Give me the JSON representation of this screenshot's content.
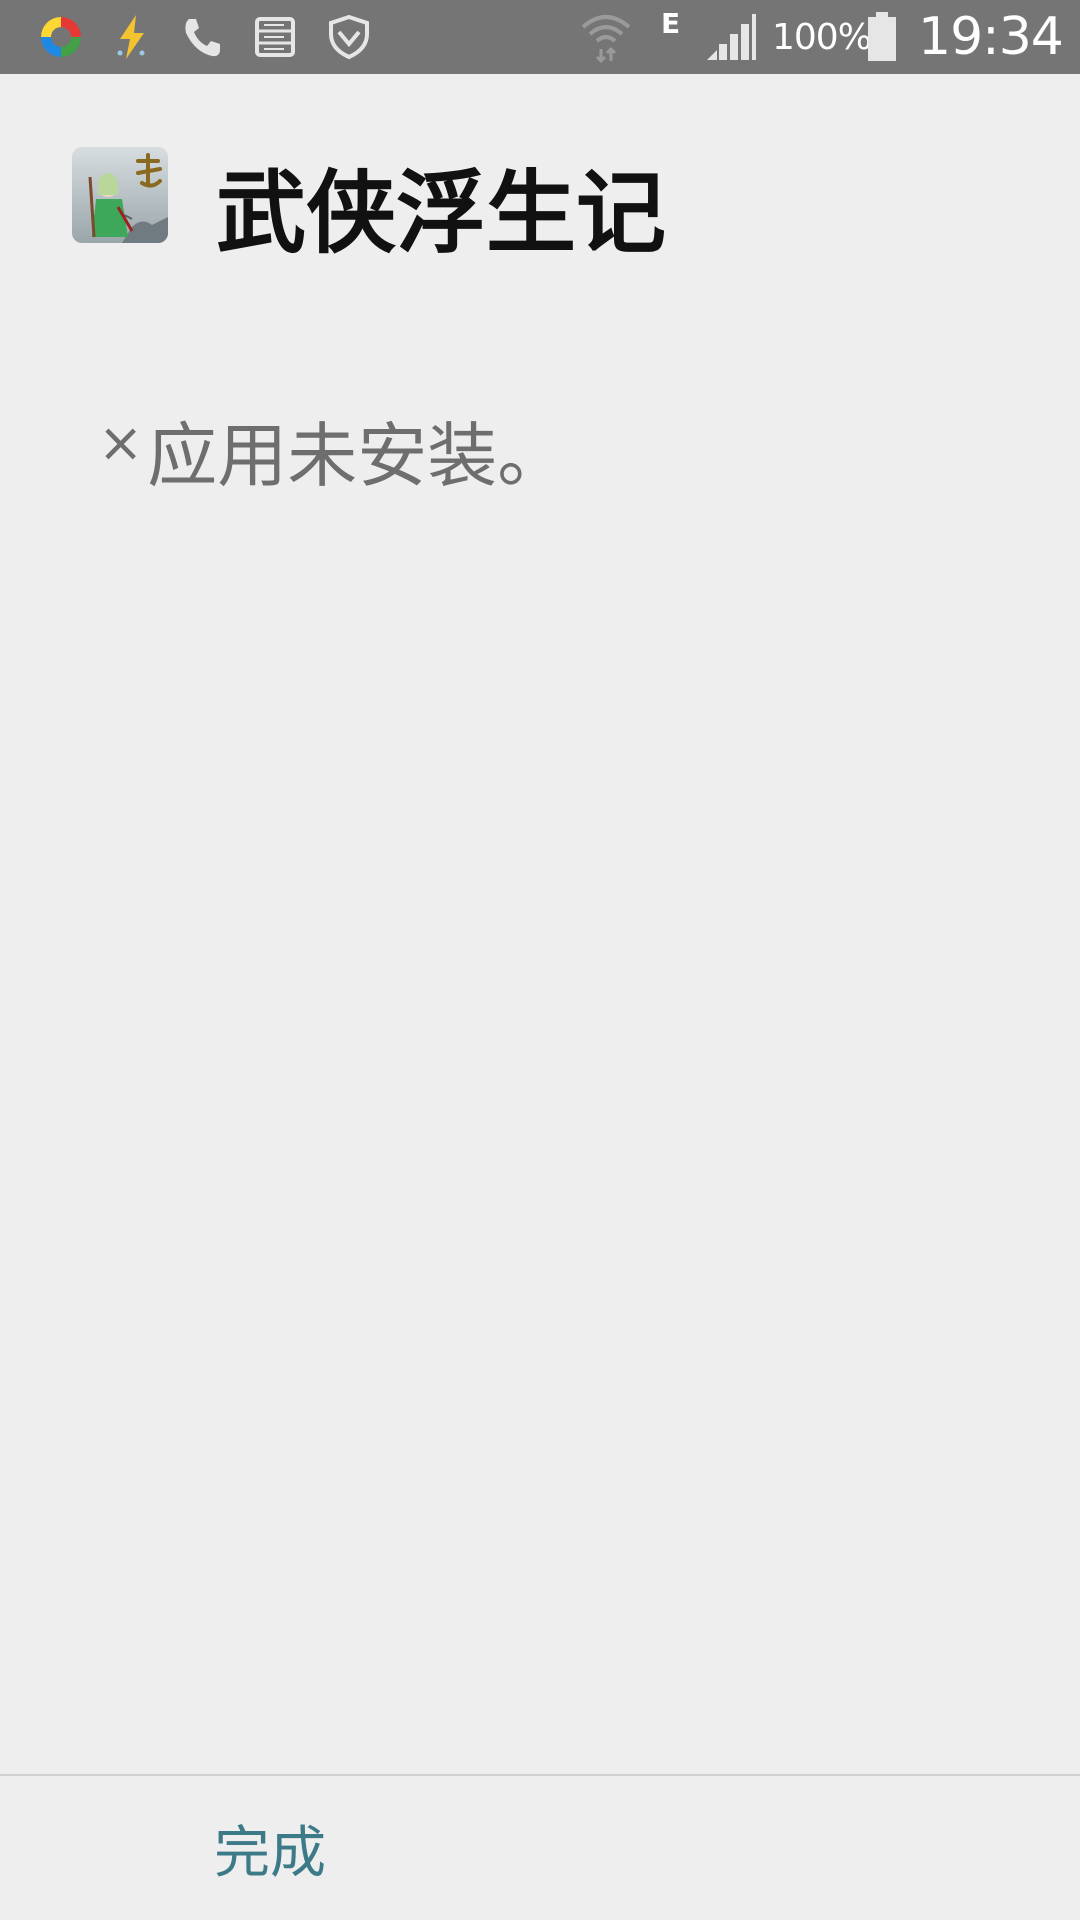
{
  "status_bar": {
    "background": "#757575",
    "left_icons": [
      "multicolor-app-icon",
      "lightning-icon",
      "phone-icon",
      "storage-icon",
      "shield-icon"
    ],
    "right_icons": [
      "wifi-icon",
      "signal-icon",
      "battery-icon"
    ],
    "network_type": "E",
    "battery_percent": "100%",
    "time": "19:34"
  },
  "app": {
    "icon": "app-icon",
    "name": "武侠浮生记"
  },
  "message": {
    "icon": "x-mark",
    "x": "×",
    "text": "应用未安装。"
  },
  "footer": {
    "done_label": "完成",
    "accent": "#3c7a87"
  }
}
